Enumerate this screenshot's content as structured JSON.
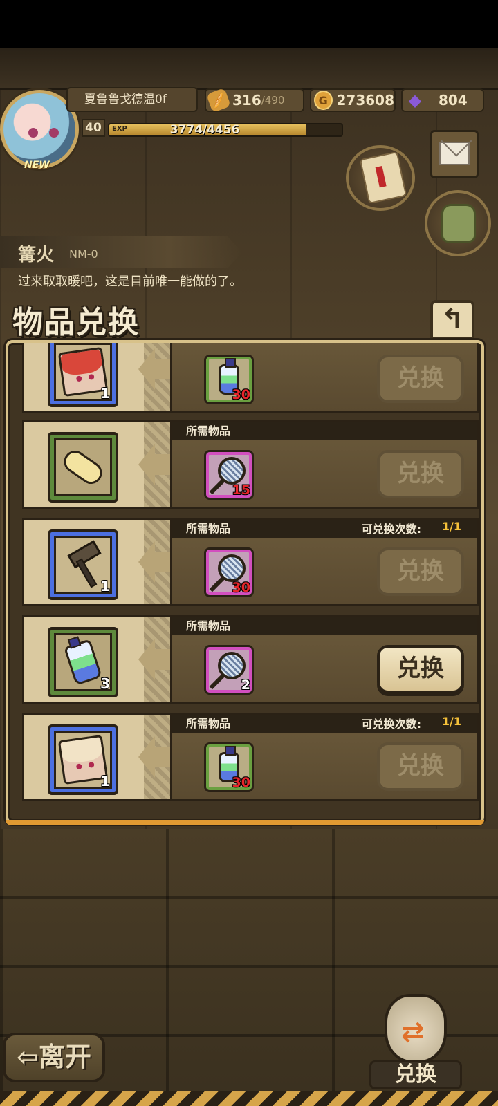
{
  "player": {
    "name": "夏鲁鲁戈德温0f",
    "avatar_badge": "NEW",
    "level": "40",
    "exp_tag": "EXP",
    "exp_text": "3774/4456",
    "exp_progress": 0.847
  },
  "resources": {
    "stamina": "316",
    "stamina_max": "/490",
    "gold": "273608",
    "gold_icon": "G",
    "gems": "804"
  },
  "location": {
    "title": "篝火",
    "code": "NM-0",
    "description": "过来取取暖吧，这是目前唯一能做的了。"
  },
  "panel": {
    "title": "物品兑换",
    "back_icon": "↰"
  },
  "exchange_rows": [
    {
      "reward": {
        "icon": "character-card-icon",
        "qty": "1"
      },
      "header": "",
      "count_label": "",
      "count_value": "",
      "required": {
        "icon": "potion-bottle-icon",
        "qty": "30"
      },
      "button": "兑换",
      "enabled": false
    },
    {
      "reward": {
        "icon": "slipper-icon",
        "qty": ""
      },
      "header": "所需物品",
      "count_label": "",
      "count_value": "",
      "required": {
        "icon": "butterfly-net-icon",
        "qty": "15"
      },
      "button": "兑换",
      "enabled": false
    },
    {
      "reward": {
        "icon": "hammer-icon",
        "qty": "1"
      },
      "header": "所需物品",
      "count_label": "可兑换次数:",
      "count_value": "1/1",
      "required": {
        "icon": "butterfly-net-icon",
        "qty": "30"
      },
      "button": "兑换",
      "enabled": false
    },
    {
      "reward": {
        "icon": "potion-bottle-icon",
        "qty": "3"
      },
      "header": "所需物品",
      "count_label": "",
      "count_value": "",
      "required": {
        "icon": "butterfly-net-icon",
        "qty": "2"
      },
      "button": "兑换",
      "enabled": true
    },
    {
      "reward": {
        "icon": "character-card-icon",
        "qty": "1"
      },
      "header": "所需物品",
      "count_label": "可兑换次数:",
      "count_value": "1/1",
      "required": {
        "icon": "potion-bottle-icon",
        "qty": "30"
      },
      "button": "兑换",
      "enabled": false
    }
  ],
  "footer": {
    "leave": "⇦离开",
    "exchange": "兑换"
  },
  "colors": {
    "rarity_blue": "#4c6fe0",
    "rarity_green": "#5e8a3c",
    "rarity_pink": "#d24fbf",
    "count_value": "#f5c13a",
    "qty_red": "#e8242a"
  }
}
